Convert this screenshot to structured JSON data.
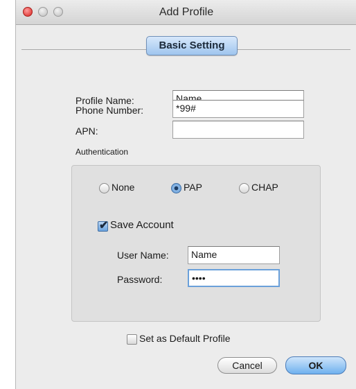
{
  "window": {
    "title": "Add Profile"
  },
  "tabs": [
    {
      "label": "Basic Setting"
    }
  ],
  "form": {
    "profile_name": {
      "label": "Profile Name:",
      "value": "Name"
    },
    "phone_number": {
      "label": "Phone Number:",
      "value": "*99#"
    },
    "apn": {
      "label": "APN:",
      "value": ""
    }
  },
  "authentication": {
    "group_label": "Authentication",
    "options": [
      {
        "label": "None"
      },
      {
        "label": "PAP"
      },
      {
        "label": "CHAP"
      }
    ],
    "selected": "PAP",
    "save_account": {
      "label": "Save Account",
      "checked": true
    },
    "user_name": {
      "label": "User Name:",
      "value": "Name"
    },
    "password": {
      "label": "Password:",
      "value": "••••"
    }
  },
  "default_profile": {
    "label": "Set as Default Profile",
    "checked": false
  },
  "buttons": {
    "cancel": "Cancel",
    "ok": "OK"
  }
}
